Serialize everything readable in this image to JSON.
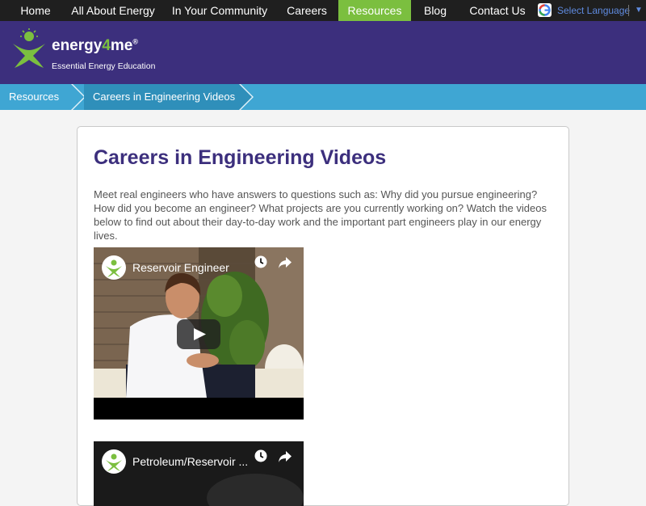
{
  "nav": {
    "items": [
      {
        "label": "Home"
      },
      {
        "label": "All About Energy"
      },
      {
        "label": "In Your Community"
      },
      {
        "label": "Careers"
      },
      {
        "label": "Resources"
      },
      {
        "label": "Blog"
      },
      {
        "label": "Contact Us"
      }
    ],
    "active_index": 4,
    "language_select": "Select Language"
  },
  "brand": {
    "name_part1": "energy",
    "name_part2": "4",
    "name_part3": "me",
    "registered": "®",
    "tagline": "Essential Energy Education"
  },
  "breadcrumb": [
    {
      "label": "Resources"
    },
    {
      "label": "Careers in Engineering Videos"
    }
  ],
  "page": {
    "title": "Careers in Engineering Videos",
    "intro": "Meet real engineers who have answers to questions such as: Why did you pursue engineering? How did you become an engineer? What projects are you currently working on? Watch the videos below to find out about their day-to-day work and the important part engineers play in our energy lives."
  },
  "videos": [
    {
      "title": "Reservoir Engineer"
    },
    {
      "title": "Petroleum/Reservoir ..."
    }
  ],
  "colors": {
    "nav_bg": "#1f1f1f",
    "nav_active": "#7bbf3f",
    "header_bg": "#3c2f7d",
    "breadcrumb_bg": "#3fa6d3",
    "title_color": "#3c2f7d"
  }
}
